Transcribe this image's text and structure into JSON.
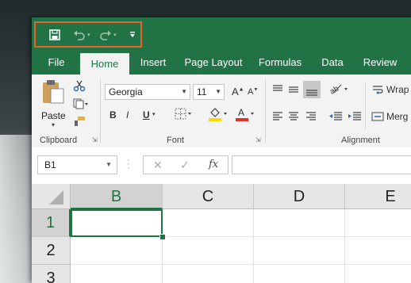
{
  "colors": {
    "accent": "#217346",
    "qat_highlight": "#e8632a",
    "font_color_bar": "#e03030",
    "highlight_bar": "#ffd800"
  },
  "quick_access": {
    "save_icon": "save-icon",
    "undo_icon": "undo-icon",
    "redo_icon": "redo-icon",
    "customize_icon": "customize-qat-icon"
  },
  "tabs": [
    "File",
    "Home",
    "Insert",
    "Page Layout",
    "Formulas",
    "Data",
    "Review"
  ],
  "ribbon": {
    "clipboard": {
      "paste_label": "Paste",
      "group_label": "Clipboard"
    },
    "font": {
      "font_name": "Georgia",
      "font_size": "11",
      "bold": "B",
      "italic": "I",
      "underline": "U",
      "group_label": "Font"
    },
    "alignment": {
      "wrap_label": "Wrap",
      "merge_label": "Merg",
      "group_label": "Alignment"
    }
  },
  "formula_bar": {
    "name_box": "B1",
    "fx": "fx",
    "formula": ""
  },
  "grid": {
    "columns": [
      "B",
      "C",
      "D",
      "E"
    ],
    "rows": [
      "1",
      "2",
      "3"
    ],
    "selected_column": "B",
    "selected_row": "1"
  }
}
